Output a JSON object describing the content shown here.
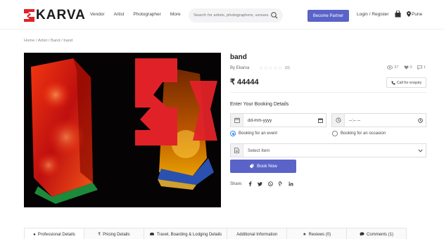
{
  "brand": {
    "name": "KARVA",
    "accent": "#e02228",
    "primary": "#5a63c8"
  },
  "nav": {
    "items": [
      "Vendor",
      "Artist",
      "Photographer",
      "More"
    ]
  },
  "search": {
    "placeholder": "Search for artists, photographers, venues...",
    "icon": "search-icon"
  },
  "header": {
    "partner_label": "Become Partner",
    "login_label": "Login / Register",
    "location_label": "Pune"
  },
  "breadcrumb": "Home / Artist / Band / band",
  "product": {
    "title": "band",
    "byline": "By Ekarva",
    "rating_stars": "☆☆☆☆☆",
    "rating_count": "(0)",
    "views": "37",
    "likes": "0",
    "comments": "1",
    "price": "₹ 44444",
    "enquiry_label": "Call for enquiry"
  },
  "booking": {
    "heading": "Enter Your Booking Details",
    "date_value": "dd-mm-yyyy",
    "time_value": "--:-- --",
    "radio_event": "Booking for an event",
    "radio_occasion": "Booking for an occasion",
    "selected_event": true,
    "select_value": "Select Item",
    "book_label": "Book Now"
  },
  "share": {
    "label": "Share:"
  },
  "tabs": [
    {
      "label": "Professional Details",
      "icon": "info-icon"
    },
    {
      "label": "Pricing Details",
      "icon": "rupee-icon"
    },
    {
      "label": "Travel, Boarding & Lodging Details",
      "icon": "car-icon"
    },
    {
      "label": "Additional Information",
      "icon": ""
    },
    {
      "label": "Reviews (0)",
      "icon": "star-icon"
    },
    {
      "label": "Comments (1)",
      "icon": "comment-icon"
    }
  ]
}
